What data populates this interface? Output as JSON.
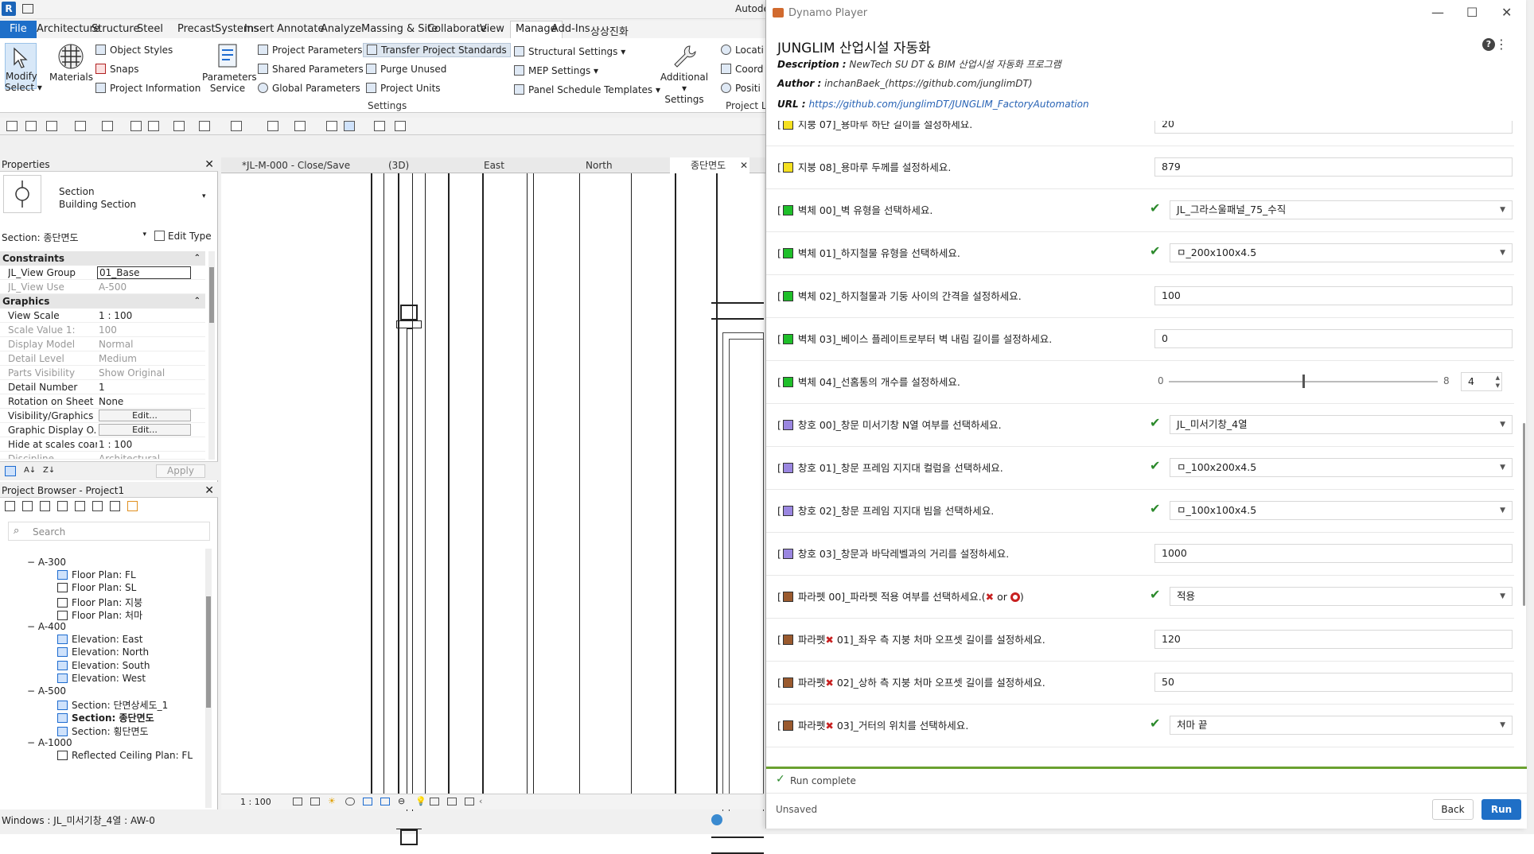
{
  "revit": {
    "app_title": "Autode",
    "menus": [
      "File",
      "Architecture",
      "Structure",
      "Steel",
      "Precast",
      "Systems",
      "Insert",
      "Annotate",
      "Analyze",
      "Massing & Site",
      "Collaborate",
      "View",
      "Manage",
      "Add-Ins",
      "상상진화"
    ],
    "ribbon": {
      "modify": "Modify",
      "select": "Select",
      "materials": "Materials",
      "object_styles": "Object  Styles",
      "snaps": "Snaps",
      "project_information": "Project  Information",
      "parameters_service_1": "Parameters",
      "parameters_service_2": "Service",
      "project_parameters": "Project  Parameters",
      "shared_parameters": "Shared  Parameters",
      "global_parameters": "Global  Parameters",
      "transfer_project_standards": "Transfer  Project Standards",
      "purge_unused": "Purge  Unused",
      "project_units": "Project  Units",
      "settings_label": "Settings",
      "structural_settings": "Structural  Settings",
      "mep_settings": "MEP  Settings",
      "panel_schedule_templates": "Panel Schedule  Templates",
      "additional_settings_1": "Additional",
      "additional_settings_2": "Settings",
      "location": "Locati",
      "coordinates": "Coord",
      "position": "Positi",
      "project_location_label": "Project L"
    },
    "properties": {
      "title": "Properties",
      "type_name_1": "Section",
      "type_name_2": "Building Section",
      "section_selector": "Section: 종단면도",
      "edit_type": "Edit Type",
      "constraints": "Constraints",
      "graphics": "Graphics",
      "rows_constraints": [
        {
          "k": "JL_View Group",
          "v": "01_Base",
          "grey": false
        },
        {
          "k": "JL_View Use",
          "v": "A-500",
          "grey": true
        }
      ],
      "rows_graphics": [
        {
          "k": "View Scale",
          "v": "1 : 100",
          "grey": false
        },
        {
          "k": "Scale Value    1:",
          "v": "100",
          "grey": true
        },
        {
          "k": "Display Model",
          "v": "Normal",
          "grey": true
        },
        {
          "k": "Detail Level",
          "v": "Medium",
          "grey": true
        },
        {
          "k": "Parts Visibility",
          "v": "Show Original",
          "grey": true
        },
        {
          "k": "Detail Number",
          "v": "1",
          "grey": false
        },
        {
          "k": "Rotation on Sheet",
          "v": "None",
          "grey": false
        }
      ],
      "vis_graphics": "Visibility/Graphics ...",
      "graphic_display": "Graphic Display O...",
      "edit_btn": "Edit...",
      "hide_scales": "Hide at scales coar...",
      "hide_scales_v": "1 : 100",
      "discipline": "Discipline",
      "discipline_v": "Architectural",
      "apply": "Apply"
    },
    "browser": {
      "title": "Project Browser - Project1",
      "search": "Search",
      "items": [
        {
          "t": "A-300",
          "kind": "group"
        },
        {
          "t": "Floor Plan: FL",
          "kind": "blue"
        },
        {
          "t": "Floor Plan: SL",
          "kind": "plain"
        },
        {
          "t": "Floor Plan: 지붕",
          "kind": "plain"
        },
        {
          "t": "Floor Plan: 처마",
          "kind": "plain"
        },
        {
          "t": "A-400",
          "kind": "group"
        },
        {
          "t": "Elevation: East",
          "kind": "blue"
        },
        {
          "t": "Elevation: North",
          "kind": "blue"
        },
        {
          "t": "Elevation: South",
          "kind": "blue"
        },
        {
          "t": "Elevation: West",
          "kind": "blue"
        },
        {
          "t": "A-500",
          "kind": "group"
        },
        {
          "t": "Section: 단면상세도_1",
          "kind": "blue"
        },
        {
          "t": "Section: 종단면도",
          "kind": "bold"
        },
        {
          "t": "Section: 횡단면도",
          "kind": "blue"
        },
        {
          "t": "A-1000",
          "kind": "group"
        },
        {
          "t": "Reflected Ceiling Plan: FL",
          "kind": "plain"
        }
      ]
    },
    "view_tabs": [
      "*JL-M-000 - Close/Save",
      "(3D)",
      "East",
      "North",
      "종단면도"
    ],
    "view_scale": "1 : 100",
    "status": "Windows : JL_미서기창_4열 : AW-0"
  },
  "dynamo": {
    "window_title": "Dynamo Player",
    "graph_title": "JUNGLIM 산업시설 자동화",
    "description_label": "Description :",
    "description": "NewTech SU DT & BIM 산업시설 자동화 프로그램",
    "author_label": "Author :",
    "author": "inchanBaek_(https://github.com/junglimDT)",
    "url_label": "URL :",
    "url": "https://github.com/junglimDT/JUNGLIM_FactoryAutomation",
    "colors": {
      "yellow": "#f5e020",
      "green": "#1fbf2a",
      "purple": "#9a86e0",
      "brown": "#9a5a2e",
      "accent": "#1f6fc6",
      "success": "#6aa12f"
    },
    "inputs": [
      {
        "color": "yellow",
        "pre": "[",
        "post": " 지붕 07]_용마루 하단 길이를 설정하세요.",
        "type": "text",
        "value": "20"
      },
      {
        "color": "yellow",
        "pre": "[",
        "post": " 지붕 08]_용마루 두께를 설정하세요.",
        "type": "text",
        "value": "879"
      },
      {
        "color": "green",
        "pre": "[",
        "post": " 벽체 00]_벽 유형을 선택하세요.",
        "type": "select",
        "value": "JL_그라스울패널_75_수직"
      },
      {
        "color": "green",
        "pre": "[",
        "post": " 벽체 01]_하지철물 유형을 선택하세요.",
        "type": "select",
        "value": "ㅁ_200x100x4.5"
      },
      {
        "color": "green",
        "pre": "[",
        "post": " 벽체 02]_하지철물과 기둥 사이의 간격을 설정하세요.",
        "type": "text",
        "value": "100"
      },
      {
        "color": "green",
        "pre": "[",
        "post": " 벽체 03]_베이스 플레이트로부터 벽 내림 길이를 설정하세요.",
        "type": "text",
        "value": "0"
      },
      {
        "color": "green",
        "pre": "[",
        "post": " 벽체 04]_선홈통의 개수를 설정하세요.",
        "type": "slider",
        "min": "0",
        "max": "8",
        "value": "4",
        "level": 0.5
      },
      {
        "color": "purple",
        "pre": "[",
        "post": " 창호 00]_창문 미서기창 N열 여부를 선택하세요.",
        "type": "select",
        "value": "JL_미서기창_4열"
      },
      {
        "color": "purple",
        "pre": "[",
        "post": " 창호 01]_창문 프레임 지지대 컬럼을 선택하세요.",
        "type": "select",
        "value": "ㅁ_100x200x4.5"
      },
      {
        "color": "purple",
        "pre": "[",
        "post": " 창호 02]_창문 프레임 지지대 빔을 선택하세요.",
        "type": "select",
        "value": "ㅁ_100x100x4.5"
      },
      {
        "color": "purple",
        "pre": "[",
        "post": " 창호 03]_창문과 바닥레벨과의 거리를 설정하세요.",
        "type": "text",
        "value": "1000"
      },
      {
        "color": "brown",
        "pre": "[",
        "post": " 파라펫 00]_파라펫 적용 여부를 선택하세요.(",
        "type": "select",
        "value": "적용",
        "suffix_or": " or ",
        "suffix_end": ")"
      },
      {
        "color": "brown",
        "pre": "[",
        "post": " 파라펫",
        "post2": " 01]_좌우 측 지붕 처마 오프셋 길이를 설정하세요.",
        "type": "text",
        "value": "120"
      },
      {
        "color": "brown",
        "pre": "[",
        "post": " 파라펫",
        "post2": " 02]_상하 측 지붕 처마 오프셋 길이를 설정하세요.",
        "type": "text",
        "value": "50"
      },
      {
        "color": "brown",
        "pre": "[",
        "post": " 파라펫",
        "post2": " 03]_거터의 위치를 선택하세요.",
        "type": "select",
        "value": "처마 끝"
      }
    ],
    "run_status": "Run complete",
    "save_status": "Unsaved",
    "back": "Back",
    "run": "Run"
  }
}
